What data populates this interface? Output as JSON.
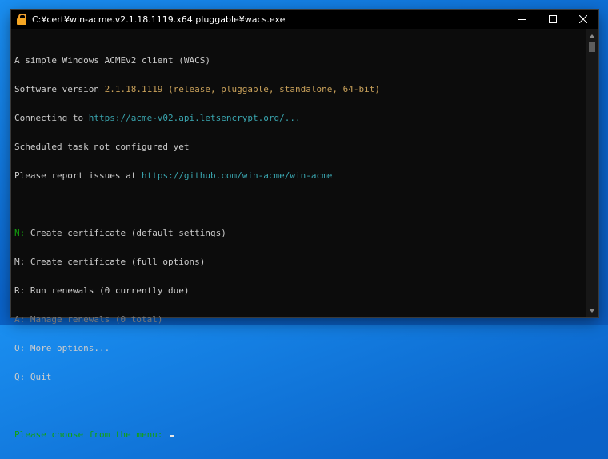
{
  "window": {
    "title": "C:¥cert¥win-acme.v2.1.18.1119.x64.pluggable¥wacs.exe",
    "icon": "lock-icon",
    "buttons": [
      "minimize-icon",
      "maximize-icon",
      "close-icon"
    ]
  },
  "console": {
    "header": {
      "line1": "A simple Windows ACMEv2 client (WACS)",
      "version_prefix": "Software version ",
      "version_value": "2.1.18.1119 (release, pluggable, standalone, 64-bit)",
      "connecting_prefix": "Connecting to ",
      "connecting_url": "https://acme-v02.api.letsencrypt.org/...",
      "scheduled": "Scheduled task not configured yet",
      "report_prefix": "Please report issues at ",
      "report_url": "https://github.com/win-acme/win-acme"
    },
    "menu": [
      {
        "key": "N:",
        "label": " Create certificate (default settings)",
        "state": "highlight"
      },
      {
        "key": "M:",
        "label": " Create certificate (full options)",
        "state": "normal"
      },
      {
        "key": "R:",
        "label": " Run renewals (0 currently due)",
        "state": "normal"
      },
      {
        "key": "A:",
        "label": " Manage renewals (0 total)",
        "state": "disabled"
      },
      {
        "key": "O:",
        "label": " More options...",
        "state": "normal"
      },
      {
        "key": "Q:",
        "label": " Quit",
        "state": "normal"
      }
    ],
    "prompt": "Please choose from the menu:"
  },
  "colors": {
    "background": "#0c0c0c",
    "text": "#cccccc",
    "version": "#c9a15a",
    "url": "#3aa6b0",
    "prompt": "#13a10e",
    "disabled": "#767676"
  }
}
